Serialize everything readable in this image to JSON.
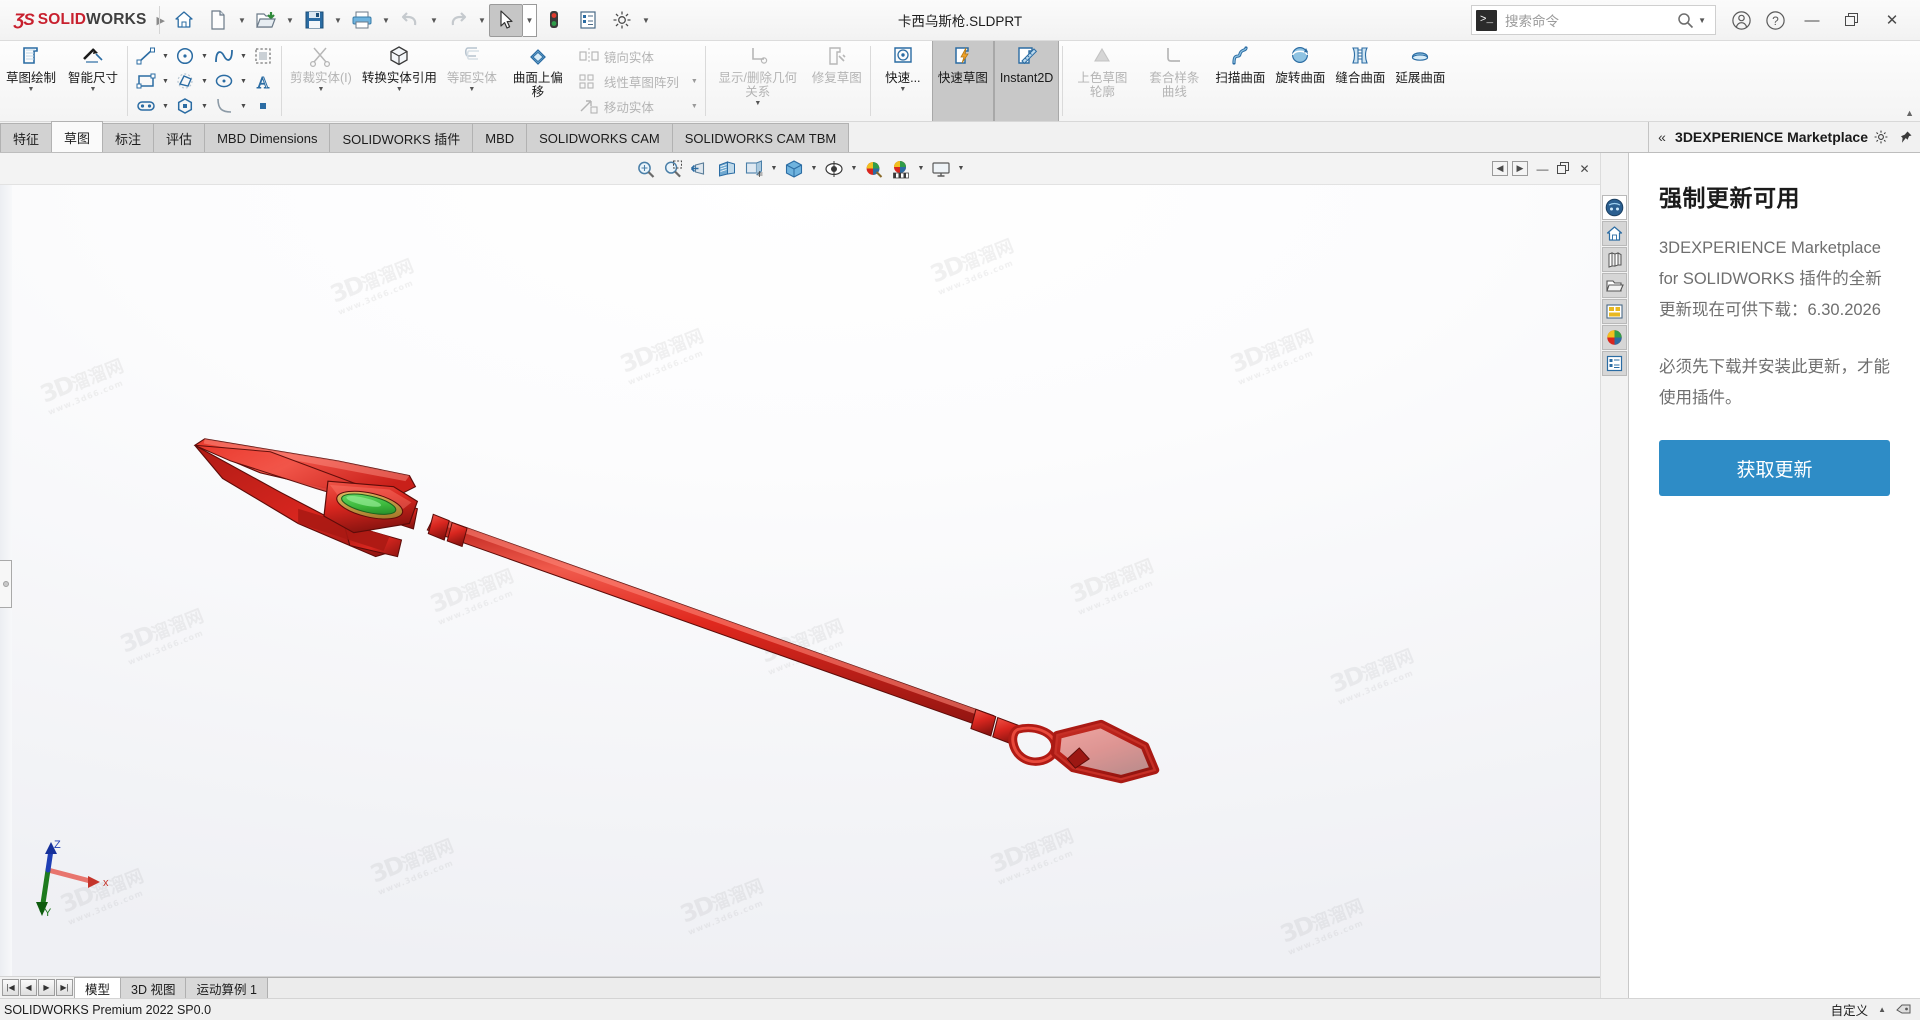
{
  "app": {
    "brand_ds": "ƷS",
    "brand_solid": "SOLID",
    "brand_works": "WORKS",
    "document_title": "卡西乌斯枪.SLDPRT",
    "status_text": "SOLIDWORKS Premium 2022 SP0.0",
    "customize_label": "自定义",
    "accent_color": "#2e8cc6",
    "brand_red": "#c8202e"
  },
  "quick_access": {
    "items": [
      {
        "name": "home-icon",
        "label": "主页",
        "has_caret": false
      },
      {
        "name": "new-document-icon",
        "label": "新建",
        "has_caret": true
      },
      {
        "name": "open-folder-icon",
        "label": "打开",
        "has_caret": true
      },
      {
        "name": "save-icon",
        "label": "保存",
        "has_caret": true
      },
      {
        "name": "print-icon",
        "label": "打印",
        "has_caret": true
      },
      {
        "name": "undo-icon",
        "label": "撤消",
        "has_caret": true
      },
      {
        "name": "redo-icon",
        "label": "重做",
        "has_caret": true
      },
      {
        "name": "select-cursor-icon",
        "label": "选择",
        "has_caret": true
      },
      {
        "name": "rebuild-icon",
        "label": "重建模型",
        "has_caret": false
      },
      {
        "name": "file-properties-icon",
        "label": "文件属性",
        "has_caret": false
      },
      {
        "name": "options-gear-icon",
        "label": "选项",
        "has_caret": true
      }
    ]
  },
  "search": {
    "placeholder": "搜索命令",
    "command_icon_glyph": ">_",
    "magnifier_icon": "search-icon"
  },
  "window_controls": {
    "account_label": "账户",
    "help_label": "帮助",
    "minimize": "—",
    "restore": "❐",
    "close": "✕"
  },
  "ribbon": {
    "groups": [
      {
        "name": "sketch-main",
        "commands": [
          {
            "name": "sketch-button",
            "label": "草图绘制",
            "icon": "sketch-icon",
            "dropdown": true,
            "disabled": false,
            "pressed": false
          },
          {
            "name": "smart-dimension-button",
            "label": "智能尺寸",
            "icon": "smart-dimension-icon",
            "dropdown": true,
            "disabled": false,
            "pressed": false
          }
        ]
      },
      {
        "name": "sketch-entities-grid",
        "rows": [
          [
            {
              "name": "line-icon",
              "label": "直线",
              "caret": true
            },
            {
              "name": "circle-icon",
              "label": "圆",
              "caret": true
            },
            {
              "name": "spline-icon",
              "label": "样条曲线",
              "caret": true
            },
            {
              "name": "trim-region-icon",
              "label": "剪裁区域",
              "caret": false
            }
          ],
          [
            {
              "name": "rectangle-icon",
              "label": "矩形",
              "caret": true
            },
            {
              "name": "polygon-slot-icon",
              "label": "槽口",
              "caret": true
            },
            {
              "name": "ellipse-icon",
              "label": "椭圆",
              "caret": true
            },
            {
              "name": "text-icon",
              "label": "文字",
              "caret": false
            }
          ],
          [
            {
              "name": "slot-icon",
              "label": "直槽口",
              "caret": true
            },
            {
              "name": "hexagon-icon",
              "label": "多边形",
              "caret": false
            },
            {
              "name": "arc-icon",
              "label": "圆弧",
              "caret": true
            },
            {
              "name": "point-icon",
              "label": "点",
              "caret": false
            }
          ]
        ]
      },
      {
        "name": "sketch-tools",
        "commands": [
          {
            "name": "trim-entities-button",
            "label": "剪裁实体(I)",
            "icon": "trim-icon",
            "dropdown": true,
            "disabled": true,
            "pressed": false
          },
          {
            "name": "convert-entities-button",
            "label": "转换实体引用",
            "icon": "convert-entities-icon",
            "dropdown": true,
            "disabled": false,
            "pressed": false
          },
          {
            "name": "offset-entities-button",
            "label": "等距实体",
            "icon": "offset-icon",
            "dropdown": true,
            "disabled": true,
            "pressed": false
          },
          {
            "name": "offset-on-surface-button",
            "label": "曲面上偏移",
            "icon": "offset-surface-icon",
            "dropdown": false,
            "disabled": false,
            "pressed": false
          }
        ]
      },
      {
        "name": "sketch-pattern-list",
        "rows": [
          {
            "name": "mirror-entities-item",
            "label": "镜向实体",
            "icon": "mirror-icon",
            "caret": false
          },
          {
            "name": "linear-sketch-pattern-item",
            "label": "线性草图阵列",
            "icon": "linear-pattern-icon",
            "caret": true
          },
          {
            "name": "move-entities-item",
            "label": "移动实体",
            "icon": "move-entities-icon",
            "caret": true
          }
        ]
      },
      {
        "name": "relations-repair",
        "commands": [
          {
            "name": "display-delete-relations-button",
            "label": "显示/删除几何关系",
            "icon": "relations-icon",
            "dropdown": true,
            "disabled": true,
            "pressed": false
          },
          {
            "name": "repair-sketch-button",
            "label": "修复草图",
            "icon": "repair-sketch-icon",
            "dropdown": false,
            "disabled": true,
            "pressed": false
          }
        ]
      },
      {
        "name": "snap-quick",
        "commands": [
          {
            "name": "quick-snaps-button",
            "label": "快速...",
            "icon": "quick-snaps-icon",
            "dropdown": true,
            "disabled": false,
            "pressed": false
          },
          {
            "name": "rapid-sketch-button",
            "label": "快速草图",
            "icon": "rapid-sketch-icon",
            "dropdown": false,
            "disabled": false,
            "pressed": true
          },
          {
            "name": "instant2d-button",
            "label": "Instant2D",
            "icon": "instant2d-icon",
            "dropdown": false,
            "disabled": false,
            "pressed": true
          }
        ]
      },
      {
        "name": "surface-tools",
        "commands": [
          {
            "name": "shaded-sketch-contours-button",
            "label": "上色草图轮廓",
            "icon": "shaded-contour-icon",
            "dropdown": false,
            "disabled": true,
            "pressed": false
          },
          {
            "name": "fit-spline-button",
            "label": "套合样条曲线",
            "icon": "fit-spline-icon",
            "dropdown": false,
            "disabled": true,
            "pressed": false
          },
          {
            "name": "swept-surface-button",
            "label": "扫描曲面",
            "icon": "swept-surface-icon",
            "dropdown": false,
            "disabled": false,
            "pressed": false
          },
          {
            "name": "revolved-surface-button",
            "label": "旋转曲面",
            "icon": "revolved-surface-icon",
            "dropdown": false,
            "disabled": false,
            "pressed": false
          },
          {
            "name": "knit-surface-button",
            "label": "缝合曲面",
            "icon": "knit-surface-icon",
            "dropdown": false,
            "disabled": false,
            "pressed": false
          },
          {
            "name": "extend-surface-button",
            "label": "延展曲面",
            "icon": "extend-surface-icon",
            "dropdown": false,
            "disabled": false,
            "pressed": false
          }
        ]
      }
    ]
  },
  "tabs": {
    "items": [
      {
        "name": "tab-features",
        "label": "特征",
        "selected": false
      },
      {
        "name": "tab-sketch",
        "label": "草图",
        "selected": true
      },
      {
        "name": "tab-markup",
        "label": "标注",
        "selected": false
      },
      {
        "name": "tab-evaluate",
        "label": "评估",
        "selected": false
      },
      {
        "name": "tab-mbd-dimensions",
        "label": "MBD Dimensions",
        "selected": false
      },
      {
        "name": "tab-solidworks-addins",
        "label": "SOLIDWORKS 插件",
        "selected": false
      },
      {
        "name": "tab-mbd",
        "label": "MBD",
        "selected": false
      },
      {
        "name": "tab-solidworks-cam",
        "label": "SOLIDWORKS CAM",
        "selected": false
      },
      {
        "name": "tab-solidworks-cam-tbm",
        "label": "SOLIDWORKS CAM TBM",
        "selected": false
      }
    ]
  },
  "view_toolbar": {
    "items": [
      {
        "name": "zoom-to-fit-icon",
        "label": "整屏显示全图",
        "caret": false
      },
      {
        "name": "zoom-to-area-icon",
        "label": "局部放大",
        "caret": false
      },
      {
        "name": "previous-view-icon",
        "label": "上一视图",
        "caret": false
      },
      {
        "name": "section-view-icon",
        "label": "剖面视图",
        "caret": false
      },
      {
        "name": "view-orientation-icon",
        "label": "视图定向",
        "caret": false
      },
      {
        "name": "display-style-icon",
        "label": "显示样式",
        "caret": true
      },
      {
        "name": "hide-show-items-icon",
        "label": "隐藏/显示项目",
        "caret": true
      },
      {
        "name": "edit-appearance-icon",
        "label": "编辑外观",
        "caret": true
      },
      {
        "name": "apply-scene-icon",
        "label": "应用布景",
        "caret": true
      },
      {
        "name": "view-settings-icon",
        "label": "视图设定",
        "caret": true
      }
    ]
  },
  "document_window_controls": {
    "prev_label": "◀",
    "next_label": "▶",
    "minimize": "—",
    "restore": "❐",
    "close": "✕"
  },
  "task_pane": {
    "collapse_icon": "chevrons-left-icon",
    "title": "3DEXPERIENCE Marketplace",
    "settings_icon": "gear-icon",
    "pin_icon": "pin-icon",
    "heading": "强制更新可用",
    "paragraph_1": "3DEXPERIENCE Marketplace for SOLIDWORKS 插件的全新更新现在可供下载：6.30.2026",
    "paragraph_2": "必须先下载并安装此更新，才能使用插件。",
    "button_label": "获取更新"
  },
  "right_dock": {
    "items": [
      {
        "name": "dock-3dexperience-marketplace",
        "icon": "globe-3d-icon",
        "selected": true
      },
      {
        "name": "dock-solidworks-resources",
        "icon": "home-icon",
        "selected": false
      },
      {
        "name": "dock-design-library",
        "icon": "library-books-icon",
        "selected": false
      },
      {
        "name": "dock-file-explorer",
        "icon": "folder-icon",
        "selected": false
      },
      {
        "name": "dock-view-palette",
        "icon": "view-palette-icon",
        "selected": false
      },
      {
        "name": "dock-appearances-scenes",
        "icon": "appearances-sphere-icon",
        "selected": false
      },
      {
        "name": "dock-custom-properties",
        "icon": "properties-list-icon",
        "selected": false
      }
    ]
  },
  "bottom_tabs": {
    "nav": [
      {
        "name": "first-tab-button",
        "glyph": "|◀"
      },
      {
        "name": "prev-tab-button",
        "glyph": "◀"
      },
      {
        "name": "next-tab-button",
        "glyph": "▶"
      },
      {
        "name": "last-tab-button",
        "glyph": "▶|"
      }
    ],
    "items": [
      {
        "name": "bottom-tab-model",
        "label": "模型",
        "selected": true
      },
      {
        "name": "bottom-tab-3d-views",
        "label": "3D 视图",
        "selected": false
      },
      {
        "name": "bottom-tab-motion-study",
        "label": "运动算例 1",
        "selected": false
      }
    ]
  },
  "viewport": {
    "triad": {
      "x_label": "x",
      "y_label": "Y",
      "z_label": "Z"
    },
    "model_name": "卡西乌斯枪",
    "model_colors": {
      "body": "#d8261f",
      "highlight": "#f2564a",
      "shadow": "#8e1410",
      "gem": "#3fbf3f",
      "gem_ring": "#c08a30"
    },
    "watermark_text": "3D溜溜网",
    "watermark_sub": "www.3d66.com"
  }
}
